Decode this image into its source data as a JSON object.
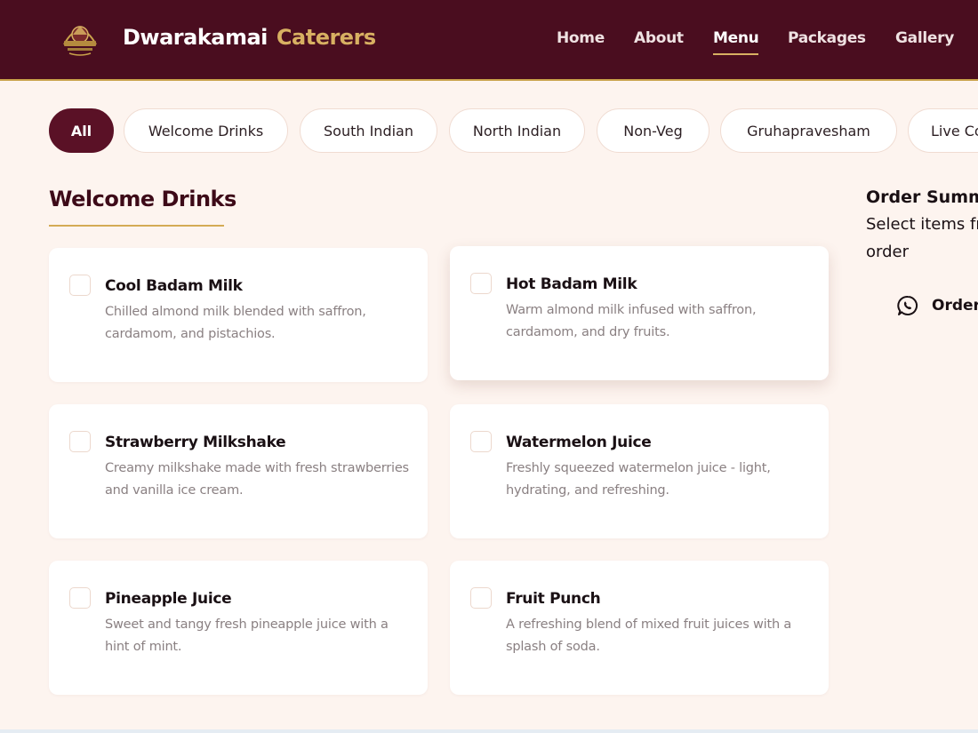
{
  "brand": {
    "name": "Dwarakamai",
    "accent": "Caterers",
    "colors": {
      "nav_bg": "#4a0d1f",
      "gold": "#d8b062",
      "active_chip": "#5a1126",
      "page_bg": "#fdf4ef"
    }
  },
  "nav": {
    "links": [
      {
        "label": "Home"
      },
      {
        "label": "About"
      },
      {
        "label": "Menu",
        "active": true
      },
      {
        "label": "Packages"
      },
      {
        "label": "Gallery"
      }
    ]
  },
  "filters": {
    "chips": [
      {
        "label": "All",
        "active": true
      },
      {
        "label": "Welcome Drinks"
      },
      {
        "label": "South Indian"
      },
      {
        "label": "North Indian"
      },
      {
        "label": "Non-Veg"
      },
      {
        "label": "Gruhapravesham"
      },
      {
        "label": "Live Co"
      }
    ]
  },
  "section": {
    "title": "Welcome Drinks"
  },
  "items": [
    {
      "title": "Cool Badam Milk",
      "desc": "Chilled almond milk blended with saffron, cardamom, and pistachios.",
      "checked": false
    },
    {
      "title": "Hot Badam Milk",
      "desc": "Warm almond milk infused with saffron, cardamom, and dry fruits.",
      "checked": false
    },
    {
      "title": "Strawberry Milkshake",
      "desc": "Creamy milkshake made with fresh strawberries and vanilla ice cream.",
      "checked": false
    },
    {
      "title": "Watermelon Juice",
      "desc": "Freshly squeezed watermelon juice - light, hydrating, and refreshing.",
      "checked": false
    },
    {
      "title": "Pineapple Juice",
      "desc": "Sweet and tangy fresh pineapple juice with a hint of mint.",
      "checked": false
    },
    {
      "title": "Fruit Punch",
      "desc": "A refreshing blend of mixed fruit juices with a splash of soda.",
      "checked": false
    }
  ],
  "summary": {
    "title": "Order Summa",
    "subtitle_line1": "Select items fr",
    "subtitle_line2": "order",
    "order_label": "Order",
    "order_icon": "whatsapp-icon"
  }
}
